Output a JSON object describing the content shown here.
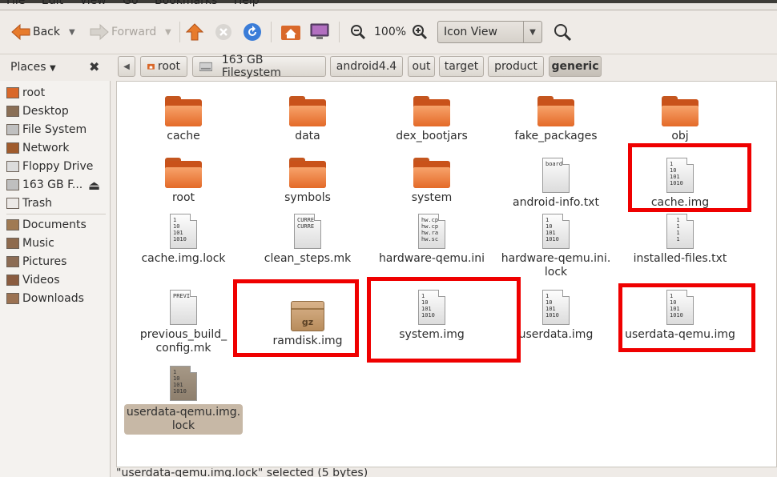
{
  "menubar": {
    "items": [
      "File",
      "Edit",
      "View",
      "Go",
      "Bookmarks",
      "Help"
    ]
  },
  "toolbar": {
    "back_label": "Back",
    "forward_label": "Forward",
    "zoom_level": "100%",
    "view_mode": "Icon View"
  },
  "places": {
    "header": "Places",
    "items": [
      {
        "label": "root",
        "icon": "home-folder-icon"
      },
      {
        "label": "Desktop",
        "icon": "desktop-icon"
      },
      {
        "label": "File System",
        "icon": "filesystem-icon"
      },
      {
        "label": "Network",
        "icon": "network-icon"
      },
      {
        "label": "Floppy Drive",
        "icon": "floppy-icon"
      },
      {
        "label": "163 GB F...",
        "icon": "harddisk-icon"
      },
      {
        "label": "Trash",
        "icon": "trash-icon"
      },
      {
        "label": "Documents",
        "icon": "documents-icon"
      },
      {
        "label": "Music",
        "icon": "music-icon"
      },
      {
        "label": "Pictures",
        "icon": "pictures-icon"
      },
      {
        "label": "Videos",
        "icon": "videos-icon"
      },
      {
        "label": "Downloads",
        "icon": "downloads-icon"
      }
    ]
  },
  "pathbar": [
    "root",
    "163 GB Filesystem",
    "android4.4",
    "out",
    "target",
    "product",
    "generic"
  ],
  "files": [
    {
      "name": "cache",
      "type": "folder"
    },
    {
      "name": "data",
      "type": "folder"
    },
    {
      "name": "dex_bootjars",
      "type": "folder"
    },
    {
      "name": "fake_packages",
      "type": "folder"
    },
    {
      "name": "obj",
      "type": "folder"
    },
    {
      "name": "root",
      "type": "folder"
    },
    {
      "name": "symbols",
      "type": "folder"
    },
    {
      "name": "system",
      "type": "folder"
    },
    {
      "name": "android-info.txt",
      "type": "text",
      "preview": "board"
    },
    {
      "name": "cache.img",
      "type": "binary",
      "preview": "1\n10\n101\n1010"
    },
    {
      "name": "cache.img.lock",
      "type": "binary",
      "preview": "1\n10\n101\n1010"
    },
    {
      "name": "clean_steps.mk",
      "type": "text",
      "preview": "CURRE\nCURRE"
    },
    {
      "name": "hardware-qemu.ini",
      "type": "text",
      "preview": "hw.cp\nhw.cp\nhw.ra\nhw.sc"
    },
    {
      "name": "hardware-qemu.ini.\nlock",
      "type": "binary",
      "preview": "1\n10\n101\n1010"
    },
    {
      "name": "installed-files.txt",
      "type": "text",
      "preview": "  1\n  1\n  1\n  1"
    },
    {
      "name": "previous_build_\nconfig.mk",
      "type": "text",
      "preview": "PREVI"
    },
    {
      "name": "ramdisk.img",
      "type": "archive",
      "preview": "gz"
    },
    {
      "name": "system.img",
      "type": "binary",
      "preview": "1\n10\n101\n1010"
    },
    {
      "name": "userdata.img",
      "type": "binary",
      "preview": "1\n10\n101\n1010"
    },
    {
      "name": "userdata-qemu.img",
      "type": "binary",
      "preview": "1\n10\n101\n1010"
    },
    {
      "name": "userdata-qemu.img.\nlock",
      "type": "binary",
      "preview": "1\n10\n101\n1010",
      "selected": true
    }
  ],
  "status": "\"userdata-qemu.img.lock\" selected (5 bytes)",
  "colors": {
    "highlight": "#ef0000",
    "selection": "#c7b8a6",
    "folder": "#e46a28"
  }
}
